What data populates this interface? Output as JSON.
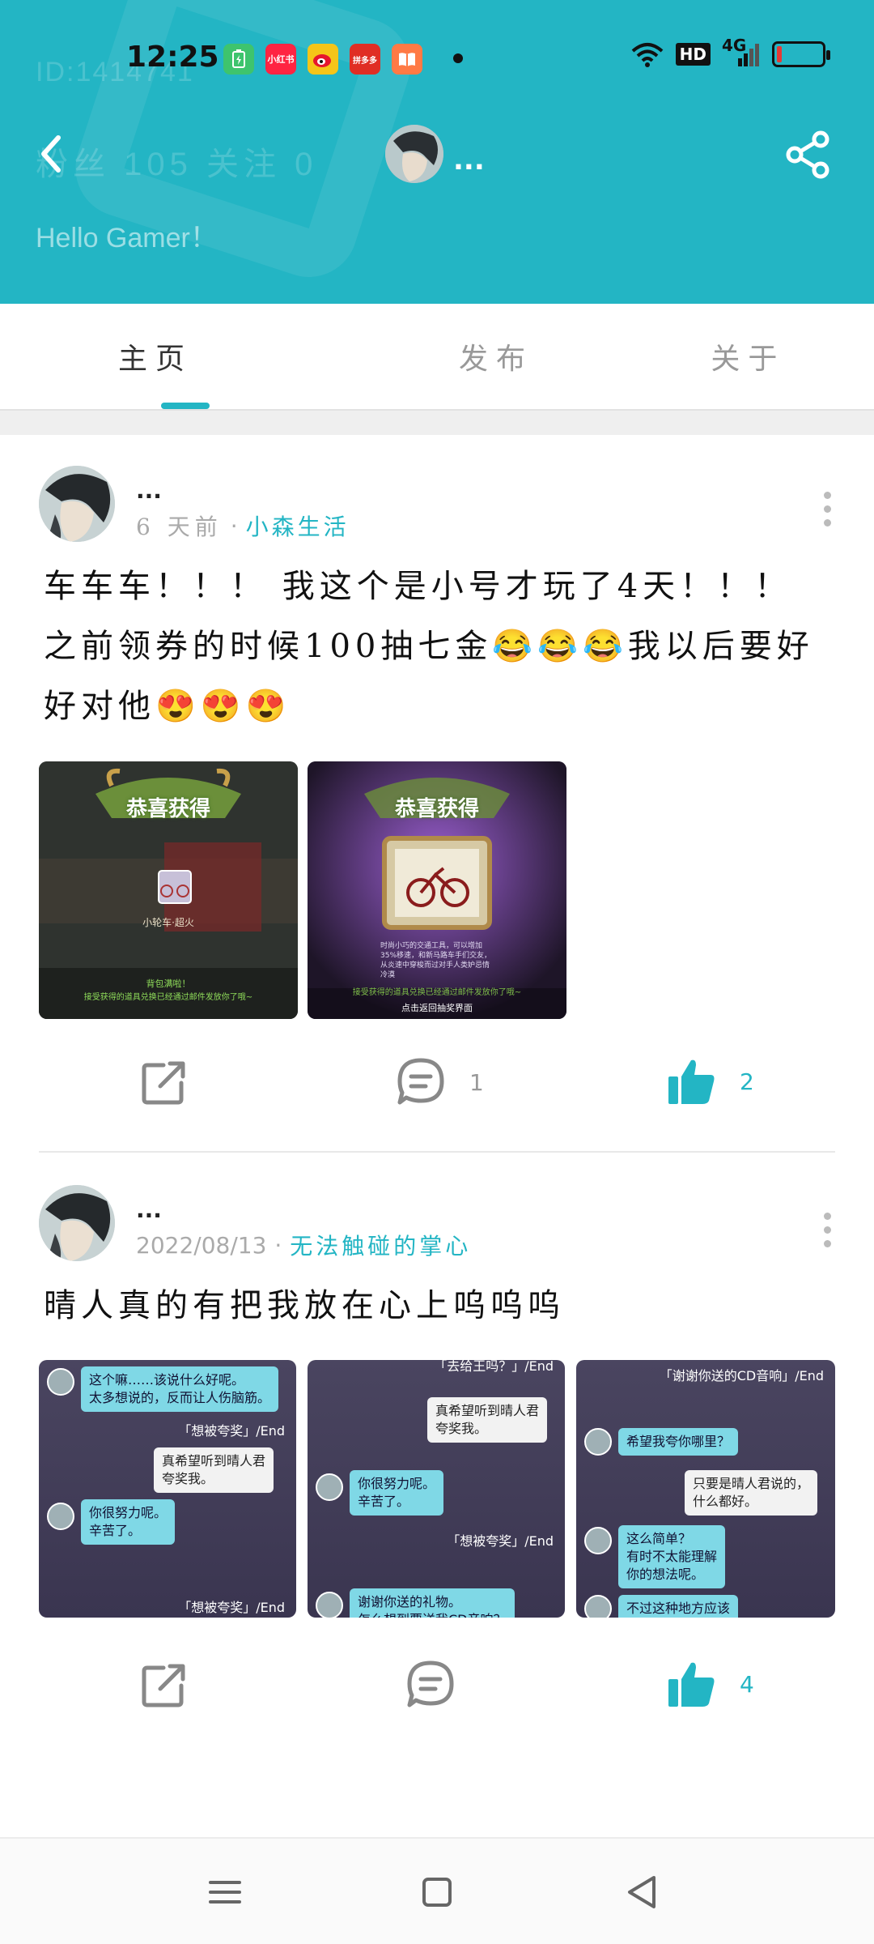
{
  "status_bar": {
    "time": "12:25",
    "net_label": "4G",
    "hd_label": "HD",
    "app_icons": [
      {
        "name": "battery-app-icon",
        "color": "#3ec46d",
        "label": ""
      },
      {
        "name": "xiaohongshu-icon",
        "color": "#ff2442",
        "label": "小红书"
      },
      {
        "name": "weibo-icon",
        "color": "#f5c518",
        "label": ""
      },
      {
        "name": "pinduoduo-icon",
        "color": "#e02e24",
        "label": "拼多多"
      },
      {
        "name": "reader-icon",
        "color": "#ff7a45",
        "label": ""
      }
    ]
  },
  "header": {
    "background_id": "ID:1414741",
    "background_stats": "粉丝 105 关注 0",
    "greeting": "Hello Gamer！",
    "username": "...",
    "accent_color": "#23b5c4"
  },
  "tabs": [
    {
      "label": "主页",
      "active": true
    },
    {
      "label": "发布",
      "active": false
    },
    {
      "label": "关于",
      "active": false
    }
  ],
  "posts": [
    {
      "author": "...",
      "time": "6 天前",
      "separator": "·",
      "topic": "小森生活",
      "text": "车车车！！！ 我这个是小号才玩了4天！！！ 之前领券的时候100抽七金😂😂😂我以后要好好对他😍😍😍",
      "images": [
        {
          "banner": "恭喜获得",
          "item": "小轮车·超火",
          "footer": "背包满啦！",
          "footer2": "接受获得的道具兑换已经通过邮件发放你了哦~"
        },
        {
          "banner": "恭喜获得",
          "item_desc": "时尚小巧的交通工具，可以增加35%移速，和新马路车手们交友，从炎速中穿梭而过对手人类妒忌情冷漠",
          "footer": "接受获得的道具兑换已经通过邮件发放你了哦~",
          "button": "点击返回抽奖界面"
        }
      ],
      "comments": "1",
      "likes": "2"
    },
    {
      "author": "...",
      "time": "2022/08/13",
      "separator": "·",
      "topic": "无法触碰的掌心",
      "text": "晴人真的有把我放在心上呜呜呜",
      "chats": [
        {
          "messages": [
            {
              "side": "left",
              "text": "这个嘛……该说什么好呢。\n太多想说的，反而让人伤脑筋。"
            },
            {
              "side": "tag",
              "text": "「想被夸奖」/End"
            },
            {
              "side": "right",
              "text": "真希望听到晴人君\n夸奖我。"
            },
            {
              "side": "left",
              "text": "你很努力呢。\n辛苦了。"
            },
            {
              "side": "tag",
              "text": "「想被夸奖」/End"
            }
          ]
        },
        {
          "messages": [
            {
              "side": "tag",
              "text": "「去给王吗？」/End"
            },
            {
              "side": "right",
              "text": "真希望听到晴人君\n夸奖我。"
            },
            {
              "side": "left",
              "text": "你很努力呢。\n辛苦了。"
            },
            {
              "side": "tag",
              "text": "「想被夸奖」/End"
            },
            {
              "side": "left",
              "text": "谢谢你送的礼物。\n怎么想到要送我CD音响？"
            }
          ]
        },
        {
          "messages": [
            {
              "side": "tag",
              "text": "「谢谢你送的CD音响」/End"
            },
            {
              "side": "left",
              "text": "希望我夸你哪里？"
            },
            {
              "side": "right",
              "text": "只要是晴人君说的，\n什么都好。"
            },
            {
              "side": "left",
              "text": "这么简单？\n有时不太能理解\n你的想法呢。"
            },
            {
              "side": "left",
              "text": "不过这种地方应该"
            }
          ]
        }
      ],
      "comments": "",
      "likes": "4"
    }
  ]
}
